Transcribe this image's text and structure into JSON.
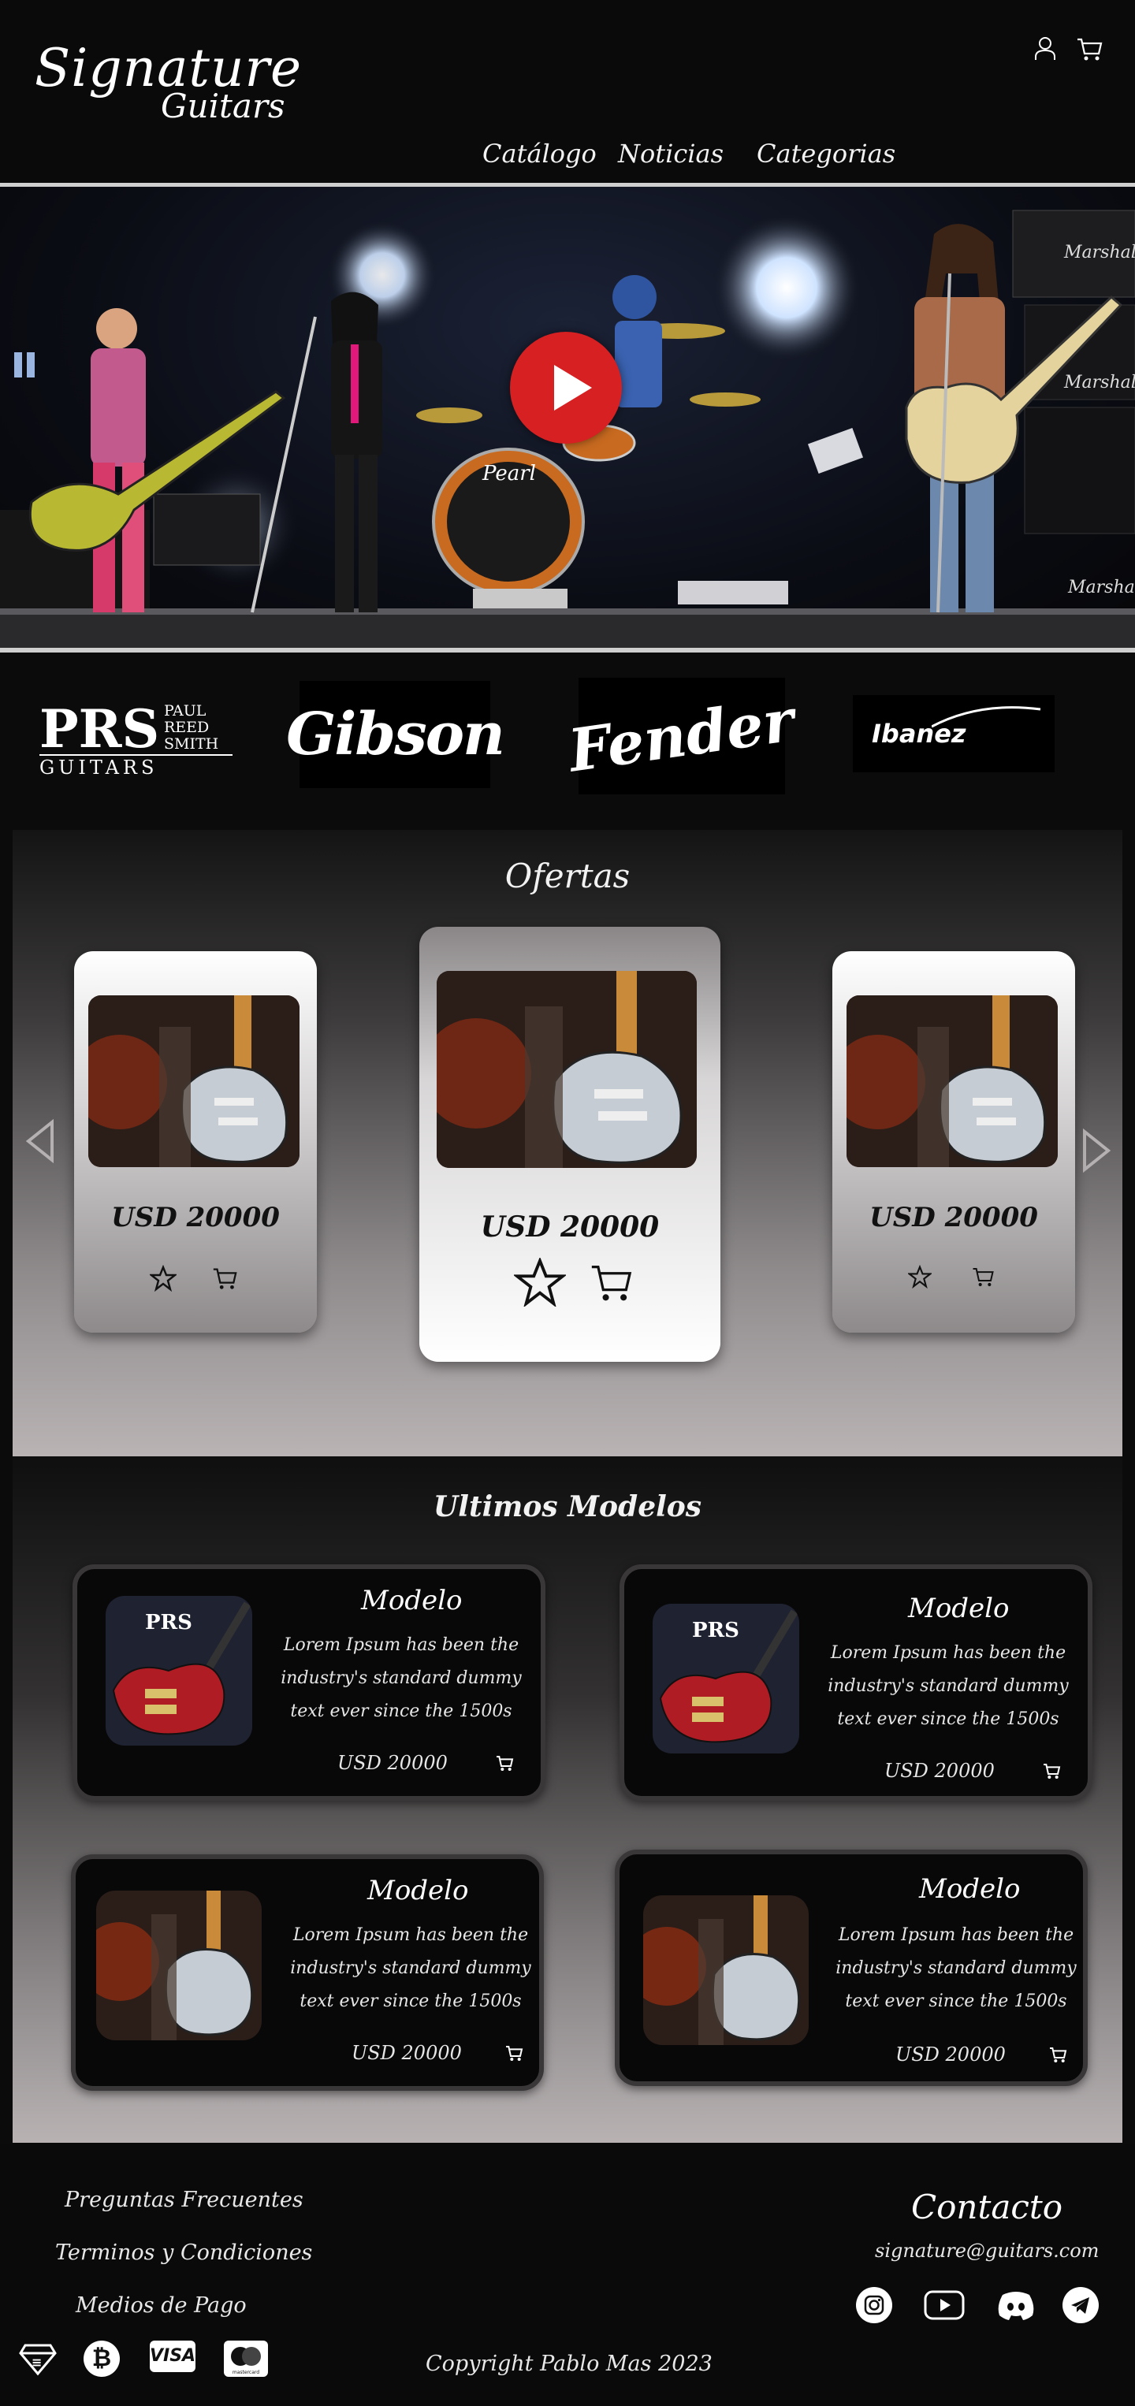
{
  "header": {
    "logo_line1": "Signature",
    "logo_line2": "Guitars",
    "nav": [
      "Catálogo",
      "Noticias",
      "Categorias"
    ]
  },
  "hero": {
    "amp_label_1": "Marshall",
    "amp_label_2": "Marshall",
    "amp_label_3": "Marshall",
    "drum_brand": "Pearl"
  },
  "brands": {
    "prs_main": "PRS",
    "prs_line1": "PAUL",
    "prs_line2": "REED",
    "prs_line3": "SMITH",
    "prs_sub": "GUITARS",
    "gibson": "Gibson",
    "fender": "Fender",
    "ibanez": "Ibanez"
  },
  "ofertas": {
    "title": "Ofertas",
    "cards": [
      {
        "price": "USD 20000"
      },
      {
        "price": "USD 20000"
      },
      {
        "price": "USD 20000"
      }
    ]
  },
  "ultimos": {
    "title": "Ultimos Modelos",
    "cards": [
      {
        "title": "Modelo",
        "desc": "Lorem Ipsum has been the industry's standard dummy text ever since the 1500s",
        "price": "USD 20000",
        "badge": "PRS"
      },
      {
        "title": "Modelo",
        "desc": "Lorem Ipsum has been the industry's standard dummy text ever since the 1500s",
        "price": "USD 20000",
        "badge": "PRS"
      },
      {
        "title": "Modelo",
        "desc": "Lorem Ipsum has been the industry's standard dummy text ever since the 1500s",
        "price": "USD 20000"
      },
      {
        "title": "Modelo",
        "desc": "Lorem Ipsum has been the industry's standard dummy text ever since the 1500s",
        "price": "USD 20000"
      }
    ]
  },
  "footer": {
    "links": [
      "Preguntas Frecuentes",
      "Terminos y Condiciones",
      "Medios de Pago"
    ],
    "contact_title": "Contacto",
    "email": "signature@guitars.com",
    "copyright": "Copyright Pablo Mas 2023",
    "visa": "VISA",
    "bitcoin": "₿",
    "mastercard": "mastercard"
  },
  "colors": {
    "play_button": "#d62021",
    "background": "#0b0b0c",
    "accent_line": "#cfcfcf"
  }
}
